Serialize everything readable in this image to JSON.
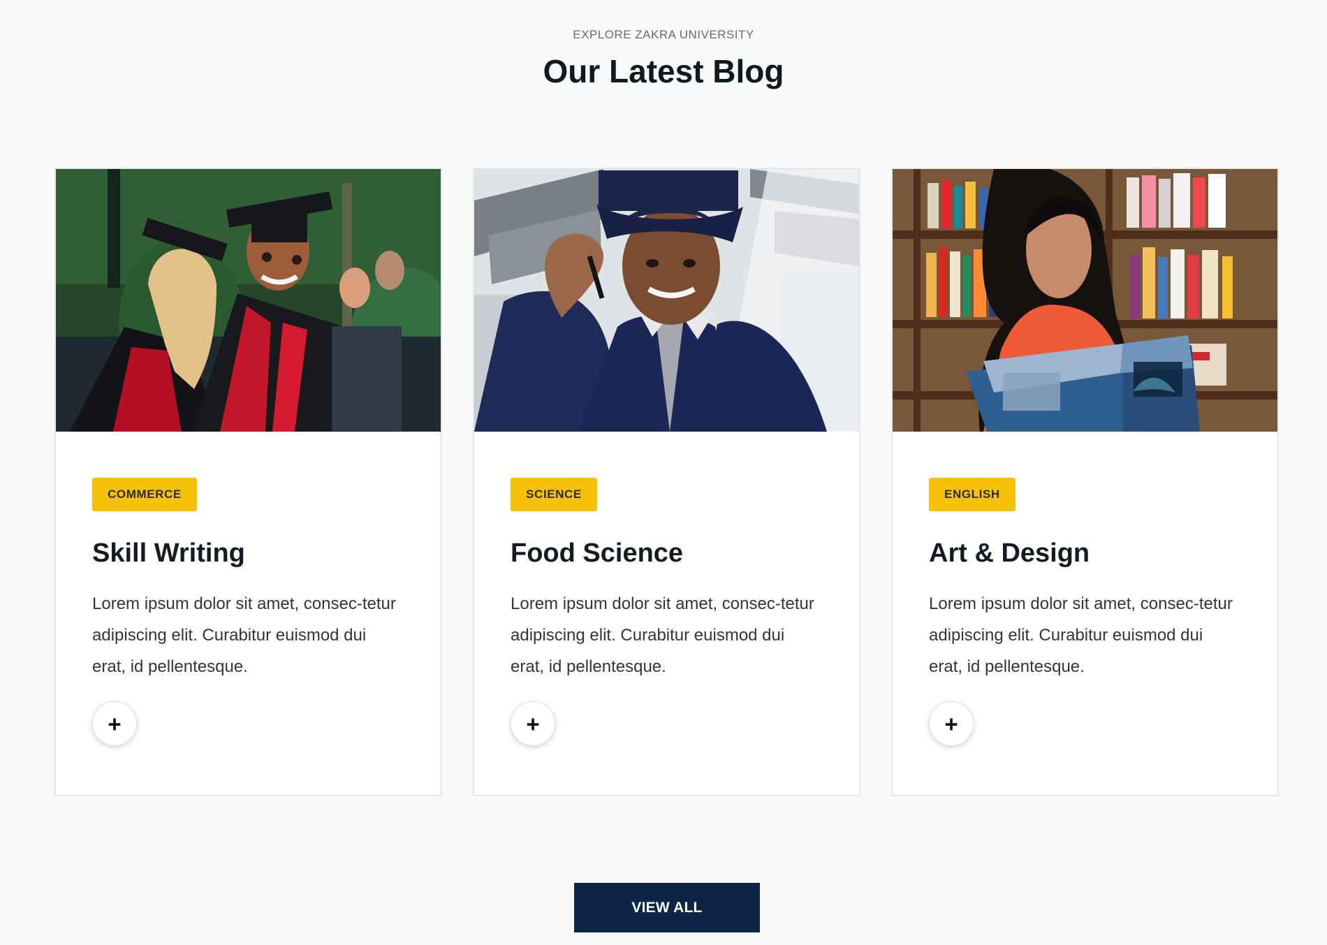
{
  "header": {
    "kicker": "EXPLORE ZAKRA UNIVERSITY",
    "title": "Our Latest Blog"
  },
  "cards": [
    {
      "image_alt": "Two graduates in caps and gowns",
      "category": "COMMERCE",
      "title": "Skill Writing",
      "excerpt": "Lorem ipsum dolor sit amet, consec-tetur adipiscing elit. Curabitur euismod dui erat, id pellentesque.",
      "button_icon": "plus-icon"
    },
    {
      "image_alt": "Graduate adjusting cap",
      "category": "SCIENCE",
      "title": "Food Science",
      "excerpt": "Lorem ipsum dolor sit amet, consec-tetur adipiscing elit. Curabitur euismod dui erat, id pellentesque.",
      "button_icon": "plus-icon"
    },
    {
      "image_alt": "Woman reading a book in a library",
      "category": "ENGLISH",
      "title": "Art & Design",
      "excerpt": "Lorem ipsum dolor sit amet, consec-tetur adipiscing elit. Curabitur euismod dui erat, id pellentesque.",
      "button_icon": "plus-icon"
    }
  ],
  "footer": {
    "view_all_label": "VIEW ALL"
  },
  "colors": {
    "background": "#f8f9fa",
    "badge": "#f5c208",
    "button": "#0f2548",
    "text": "#141b24"
  }
}
